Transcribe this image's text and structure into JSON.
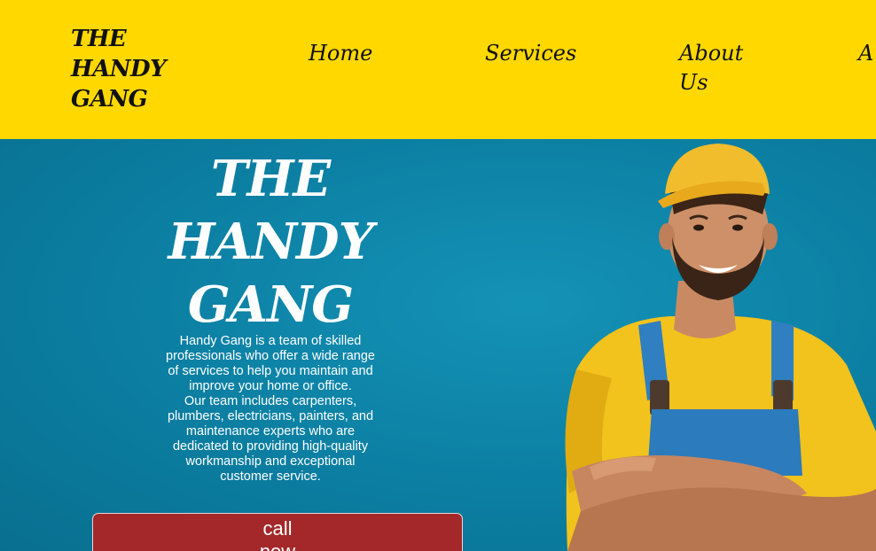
{
  "header": {
    "logo": "THE HANDY GANG",
    "nav": [
      {
        "label": "Home"
      },
      {
        "label": "Services"
      },
      {
        "label": "About\nUs"
      },
      {
        "label": "A"
      }
    ]
  },
  "hero": {
    "title": "THE\nHANDY\nGANG",
    "description_1": "Handy Gang is a team of skilled professionals who offer a wide range of services to help you maintain and improve your home or office.",
    "description_2": "Our team includes carpenters, plumbers, electricians, painters, and maintenance experts who are dedicated to providing high-quality workmanship and exceptional customer service.",
    "cta_label": "call now"
  },
  "colors": {
    "header_bg": "#ffd800",
    "hero_bg": "#0f86a8",
    "cta_bg": "#a4282a"
  }
}
